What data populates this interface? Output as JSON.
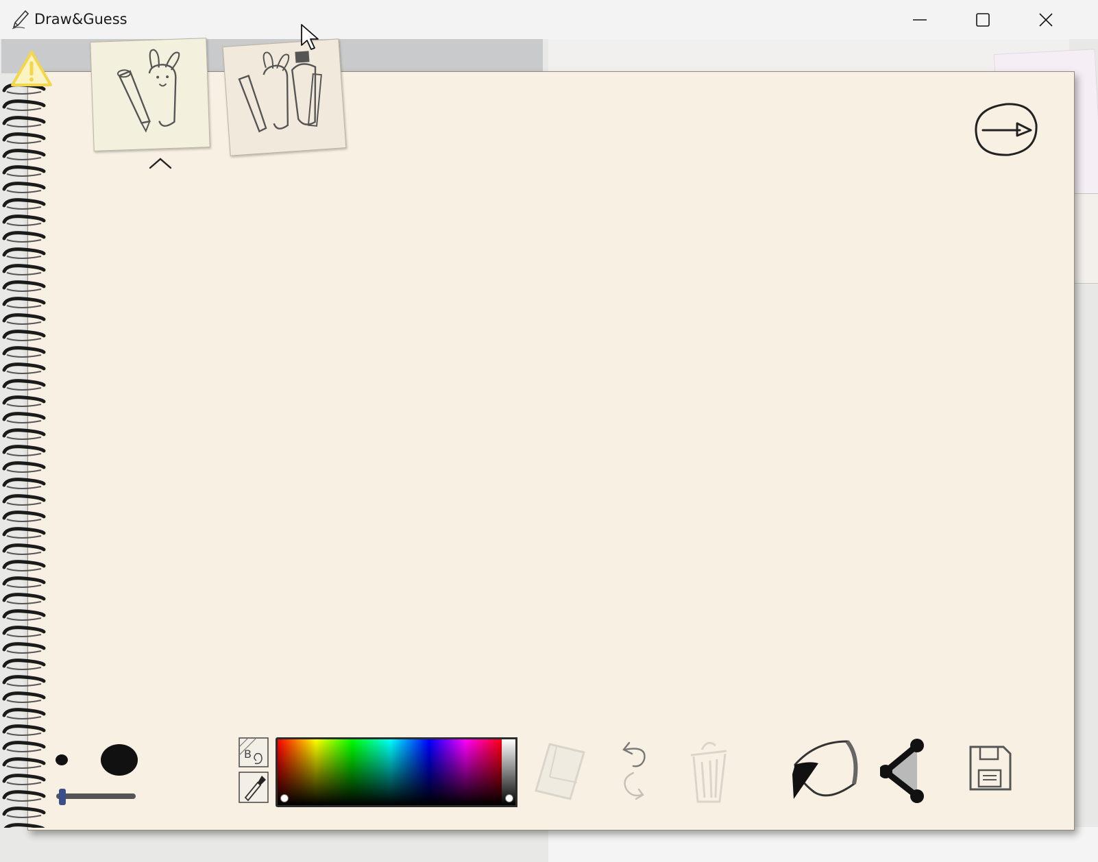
{
  "window": {
    "title": "Draw&Guess",
    "controls": [
      "minimize-icon",
      "maximize-icon",
      "close-icon"
    ]
  },
  "icons": {
    "app": "pencil-icon",
    "warning": "warning-icon",
    "card_1": "bunny-pencil-icon",
    "card_2": "bunny-group-icon",
    "collapse": "chevron-up-icon",
    "next": "arrow-right-circle-icon",
    "background": "background-pattern-icon",
    "picker": "eyedropper-icon",
    "eraser": "eraser-icon",
    "undo": "undo-icon",
    "redo": "redo-icon",
    "trash": "trash-icon",
    "pen": "pen-icon",
    "share": "share-icon",
    "save": "floppy-disk-icon"
  },
  "brush": {
    "size_level": 0.1
  },
  "colors": {
    "paper": "#f7f0e3",
    "warning": "#f2d64b",
    "ink": "#111111",
    "slider_handle": "#3a4f8a"
  },
  "tools": {
    "disabled": [
      "eraser",
      "undo",
      "redo",
      "trash"
    ],
    "active": "pen"
  }
}
